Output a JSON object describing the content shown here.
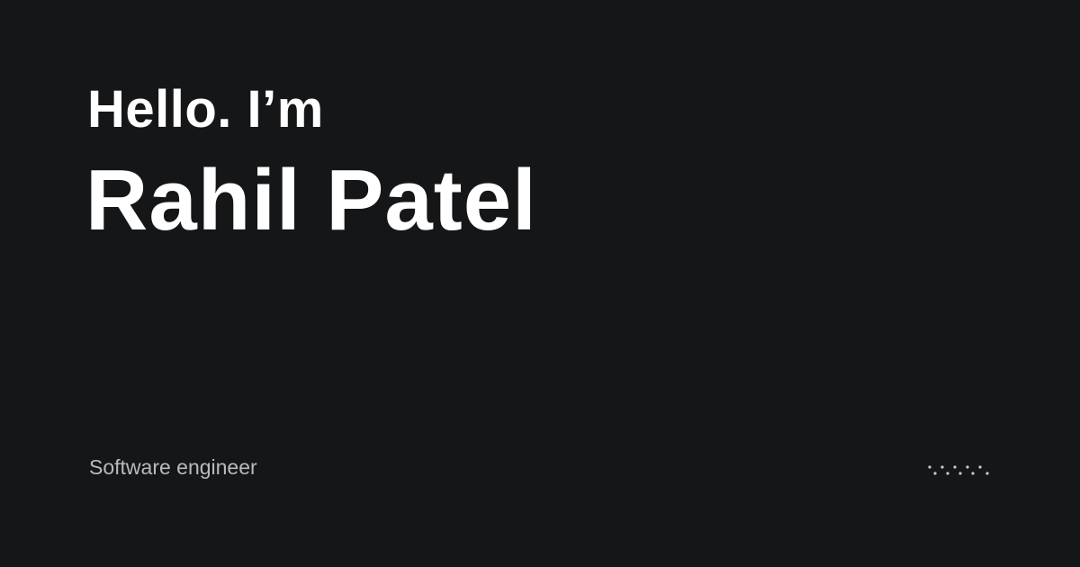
{
  "hero": {
    "greeting": "Hello. I’m",
    "name": "Rahil Patel"
  },
  "footer": {
    "role": "Software engineer",
    "decoration_icon": "dotted-wave-icon"
  },
  "colors": {
    "background": "#151618",
    "heading": "#ffffff",
    "subtext": "#b8babd",
    "dots": "#c9cbce"
  }
}
